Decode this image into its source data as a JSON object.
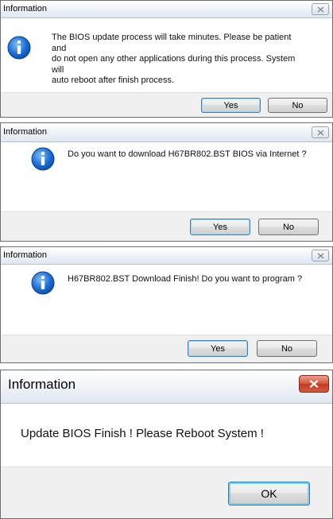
{
  "dialogs": [
    {
      "title": "Information",
      "message_lines": [
        "The BIOS update process will take minutes. Please be patient and",
        "do not open any other applications during this process.  System will",
        "auto reboot after finish process."
      ],
      "yes_label": "Yes",
      "no_label": "No",
      "icon": "info-icon"
    },
    {
      "title": "Information",
      "message": "Do you want to download H67BR802.BST BIOS via Internet ?",
      "yes_label": "Yes",
      "no_label": "No",
      "icon": "info-icon"
    },
    {
      "title": "Information",
      "message": "H67BR802.BST Download Finish! Do you want to program ?",
      "yes_label": "Yes",
      "no_label": "No",
      "icon": "info-icon"
    },
    {
      "title": "Information",
      "message": "Update BIOS Finish ! Please Reboot System !",
      "ok_label": "OK"
    }
  ],
  "colors": {
    "accent_button_border": "#3c7fb1",
    "close_red": "#c43a22",
    "info_icon_blue": "#1a6fd0",
    "footer_gray": "#f0f0f0"
  }
}
